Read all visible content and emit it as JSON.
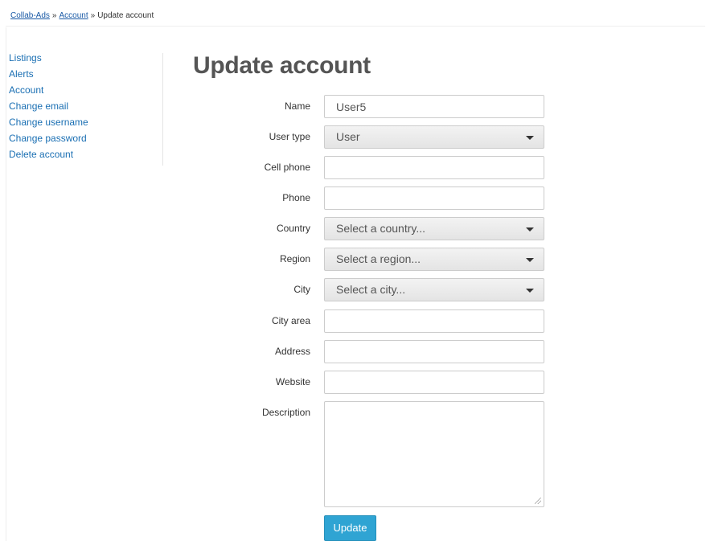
{
  "breadcrumb": {
    "home": "Collab-Ads",
    "account": "Account",
    "current": "Update account",
    "separator": "»"
  },
  "sidebar": {
    "items": [
      {
        "label": "Listings"
      },
      {
        "label": "Alerts"
      },
      {
        "label": "Account"
      },
      {
        "label": "Change email"
      },
      {
        "label": "Change username"
      },
      {
        "label": "Change password"
      },
      {
        "label": "Delete account"
      }
    ]
  },
  "title": "Update account",
  "form": {
    "name": {
      "label": "Name",
      "value": "User5"
    },
    "user_type": {
      "label": "User type",
      "value": "User"
    },
    "cell_phone": {
      "label": "Cell phone",
      "value": ""
    },
    "phone": {
      "label": "Phone",
      "value": ""
    },
    "country": {
      "label": "Country",
      "value": "Select a country..."
    },
    "region": {
      "label": "Region",
      "value": "Select a region..."
    },
    "city": {
      "label": "City",
      "value": "Select a city..."
    },
    "city_area": {
      "label": "City area",
      "value": ""
    },
    "address": {
      "label": "Address",
      "value": ""
    },
    "website": {
      "label": "Website",
      "value": ""
    },
    "description": {
      "label": "Description",
      "value": ""
    },
    "submit_label": "Update"
  },
  "colors": {
    "link": "#1a6fb3",
    "button": "#2fa4d3",
    "title": "#555555"
  }
}
